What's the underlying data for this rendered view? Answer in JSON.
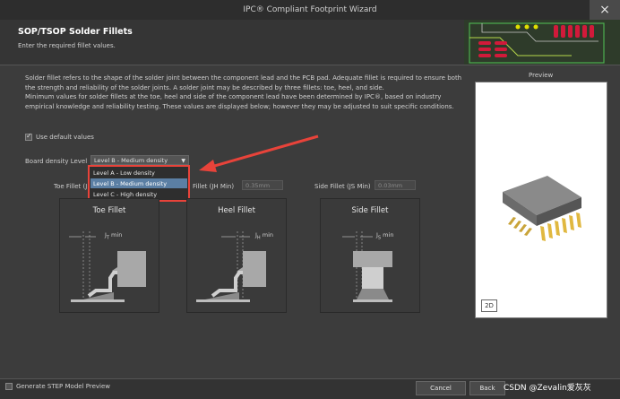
{
  "window": {
    "title": "IPC® Compliant Footprint Wizard",
    "close_glyph": "×"
  },
  "header": {
    "title": "SOP/TSOP Solder Fillets",
    "subtitle": "Enter the required fillet values."
  },
  "description": [
    "Solder fillet refers to the shape of the solder joint between the component lead and the PCB pad. Adequate fillet is required to ensure both",
    "the strength and reliability of the solder joints. A solder joint may be described by three fillets: toe, heel, and side.",
    "Minimum values for solder fillets at the toe, heel and side of the component lead have been determined by IPC®, based on industry",
    "empirical knowledge and reliability testing. These values are displayed below; however they may be adjusted to suit specific conditions."
  ],
  "use_default": {
    "label": "Use default values",
    "checked": true
  },
  "density": {
    "label": "Board density Level",
    "selected": "Level B - Medium density",
    "options": [
      "Level A - Low density",
      "Level B - Medium density",
      "Level C - High density"
    ]
  },
  "fillets": {
    "toe": {
      "label": "Toe Fillet (J",
      "value": ""
    },
    "heel": {
      "label": "Fillet (JH Min)",
      "value": "0.35mm"
    },
    "side": {
      "label": "Side Fillet (JS Min)",
      "value": "0.03mm"
    }
  },
  "panels": {
    "toe": {
      "title": "Toe Fillet",
      "dim_prefix": "J",
      "dim_sub": "T",
      "dim_suffix": " min"
    },
    "heel": {
      "title": "Heel Fillet",
      "dim_prefix": "J",
      "dim_sub": "H",
      "dim_suffix": " min"
    },
    "side": {
      "title": "Side Fillet",
      "dim_prefix": "J",
      "dim_sub": "S",
      "dim_suffix": " min"
    }
  },
  "preview": {
    "label": "Preview",
    "view_button": "2D"
  },
  "footer": {
    "step_label": "Generate STEP Model Preview",
    "cancel": "Cancel",
    "back": "Back"
  },
  "watermark": "CSDN @Zevalin爱灰灰",
  "colors": {
    "highlight": "#e8433a",
    "selected_item": "#5b7fa4"
  }
}
